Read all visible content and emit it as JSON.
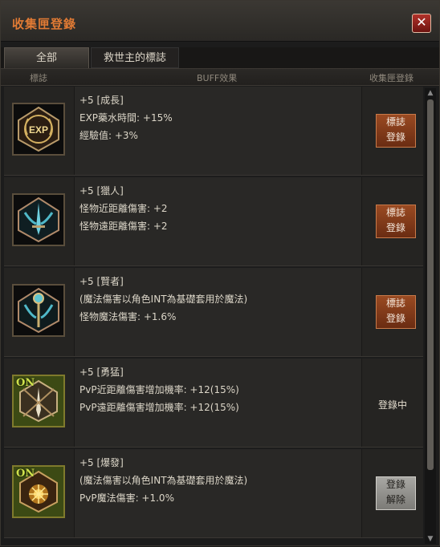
{
  "window": {
    "title": "收集匣登錄",
    "close_glyph": "✕"
  },
  "tabs": [
    {
      "label": "全部",
      "active": true
    },
    {
      "label": "救世主的標誌",
      "active": false
    }
  ],
  "columns": {
    "icon": "標誌",
    "buff": "BUFF效果",
    "register": "收集匣登錄"
  },
  "rows": [
    {
      "icon": "exp-badge-icon",
      "on": false,
      "icon_text": "EXP",
      "lines": [
        "+5 [成長]",
        "EXP藥水時間: +15%",
        "經驗值: +3%"
      ],
      "action": {
        "type": "button",
        "line1": "標誌",
        "line2": "登錄"
      }
    },
    {
      "icon": "hunter-sword-badge-icon",
      "on": false,
      "lines": [
        "+5 [獵人]",
        "怪物近距離傷害: +2",
        "怪物遠距離傷害: +2"
      ],
      "action": {
        "type": "button",
        "line1": "標誌",
        "line2": "登錄"
      }
    },
    {
      "icon": "sage-staff-badge-icon",
      "on": false,
      "lines": [
        "+5 [賢者]",
        "(魔法傷害以角色INT為基礎套用於魔法)",
        "怪物魔法傷害: +1.6%"
      ],
      "action": {
        "type": "button",
        "line1": "標誌",
        "line2": "登錄"
      }
    },
    {
      "icon": "brave-sword-badge-icon",
      "on": true,
      "on_text": "ON",
      "lines": [
        "+5 [勇猛]",
        "PvP近距離傷害增加機率: +12(15%)",
        "PvP遠距離傷害增加機率: +12(15%)"
      ],
      "action": {
        "type": "status",
        "text": "登錄中"
      }
    },
    {
      "icon": "burst-magic-badge-icon",
      "on": true,
      "on_text": "ON",
      "lines": [
        "+5 [爆發]",
        "(魔法傷害以角色INT為基礎套用於魔法)",
        "PvP魔法傷害: +1.0%"
      ],
      "action": {
        "type": "gray-button",
        "line1": "登錄",
        "line2": "解除"
      }
    }
  ],
  "scrollbar": {
    "up_glyph": "▲",
    "down_glyph": "▼"
  },
  "colors": {
    "title": "#e07a34",
    "register_button": "#8a3f1c",
    "unregister_button": "#9a9995",
    "on_badge": "#cfe24c"
  }
}
